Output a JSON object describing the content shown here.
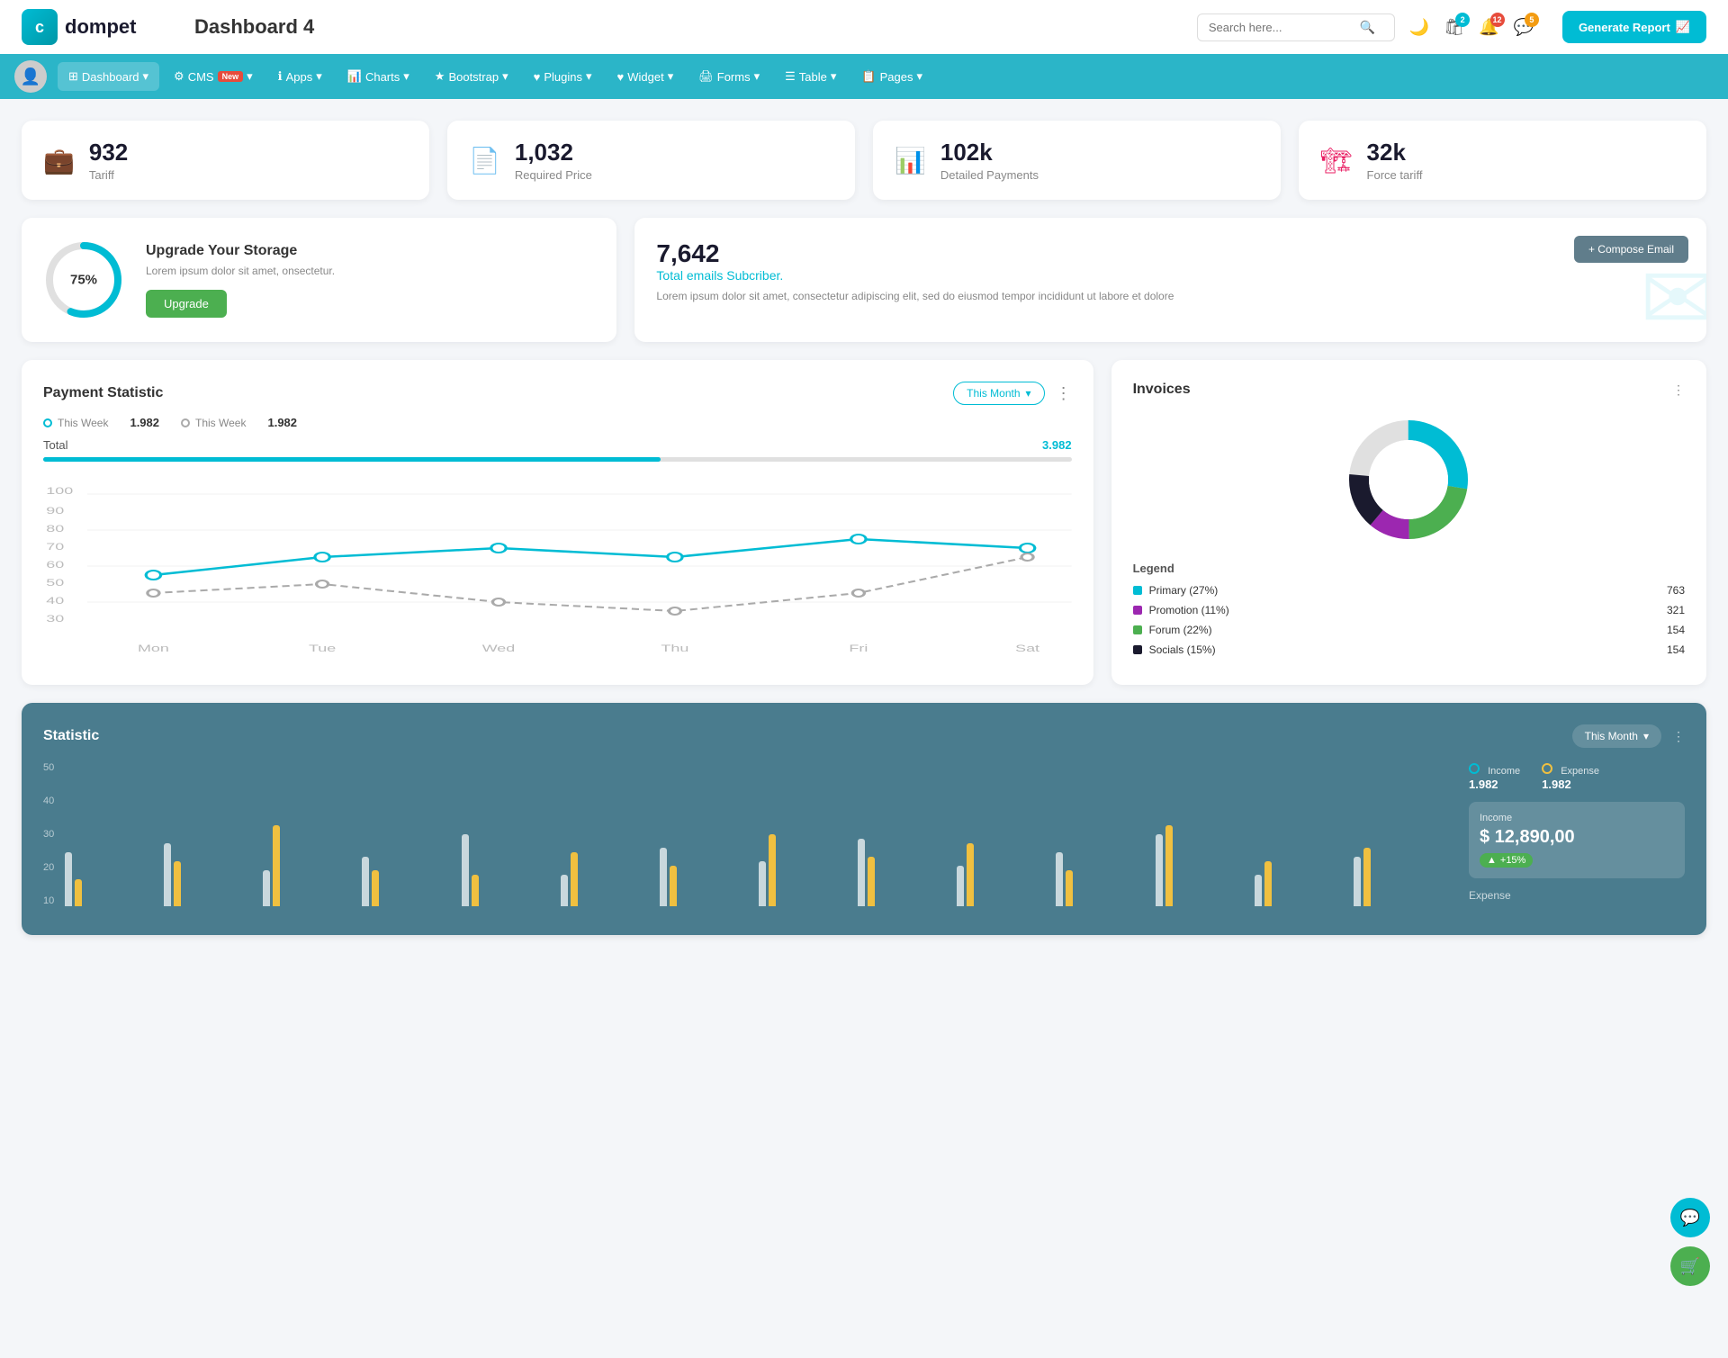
{
  "header": {
    "logo_text": "dompet",
    "page_title": "Dashboard 4",
    "search_placeholder": "Search here...",
    "generate_btn_label": "Generate Report",
    "icons": {
      "cart_badge": "2",
      "notif_badge": "12",
      "msg_badge": "5"
    }
  },
  "nav": {
    "items": [
      {
        "label": "Dashboard",
        "icon": "⊞",
        "active": true
      },
      {
        "label": "CMS",
        "icon": "⚙",
        "badge": "New"
      },
      {
        "label": "Apps",
        "icon": "ℹ"
      },
      {
        "label": "Charts",
        "icon": "📊"
      },
      {
        "label": "Bootstrap",
        "icon": "★"
      },
      {
        "label": "Plugins",
        "icon": "♥"
      },
      {
        "label": "Widget",
        "icon": "♥"
      },
      {
        "label": "Forms",
        "icon": "🖨"
      },
      {
        "label": "Table",
        "icon": "☰"
      },
      {
        "label": "Pages",
        "icon": "📋"
      }
    ]
  },
  "stat_cards": [
    {
      "value": "932",
      "label": "Tariff",
      "icon": "💼",
      "color": "#00bcd4"
    },
    {
      "value": "1,032",
      "label": "Required Price",
      "icon": "📄",
      "color": "#e74c3c"
    },
    {
      "value": "102k",
      "label": "Detailed Payments",
      "icon": "📊",
      "color": "#9c27b0"
    },
    {
      "value": "32k",
      "label": "Force tariff",
      "icon": "🏗",
      "color": "#e91e63"
    }
  ],
  "storage": {
    "percent": 75,
    "title": "Upgrade Your Storage",
    "desc": "Lorem ipsum dolor sit amet, onsectetur.",
    "btn_label": "Upgrade"
  },
  "email": {
    "number": "7,642",
    "sub_label": "Total emails Subcriber.",
    "desc": "Lorem ipsum dolor sit amet, consectetur adipiscing elit, sed do eiusmod tempor incididunt ut labore et dolore",
    "compose_btn": "+ Compose Email"
  },
  "payment": {
    "title": "Payment Statistic",
    "filter_label": "This Month",
    "legend1_label": "This Week",
    "legend1_value": "1.982",
    "legend2_label": "This Week",
    "legend2_value": "1.982",
    "total_label": "Total",
    "total_value": "3.982",
    "y_labels": [
      "100",
      "90",
      "80",
      "70",
      "60",
      "50",
      "40",
      "30"
    ],
    "x_labels": [
      "Mon",
      "Tue",
      "Wed",
      "Thu",
      "Fri",
      "Sat"
    ],
    "line1_points": "40,160 120,110 240,100 360,90 480,105 600,90",
    "line2_points": "40,130 120,120 240,130 360,150 480,130 600,95"
  },
  "invoices": {
    "title": "Invoices",
    "donut": {
      "segments": [
        {
          "label": "Primary (27%)",
          "color": "#00bcd4",
          "value": 763,
          "percent": 27
        },
        {
          "label": "Promotion (11%)",
          "color": "#9c27b0",
          "value": 321,
          "percent": 11
        },
        {
          "label": "Forum (22%)",
          "color": "#4caf50",
          "value": 154,
          "percent": 22
        },
        {
          "label": "Socials (15%)",
          "color": "#1a1a2e",
          "value": 154,
          "percent": 15
        }
      ]
    }
  },
  "statistic": {
    "title": "Statistic",
    "filter_label": "This Month",
    "income_label": "Income",
    "income_value": "1.982",
    "expense_label": "Expense",
    "expense_value": "1.982",
    "income_amount": "$ 12,890,00",
    "income_change": "+15%",
    "expense_label2": "Expense",
    "bars": [
      {
        "white": 60,
        "yellow": 30
      },
      {
        "white": 70,
        "yellow": 50
      },
      {
        "white": 40,
        "yellow": 90
      },
      {
        "white": 55,
        "yellow": 40
      },
      {
        "white": 80,
        "yellow": 35
      },
      {
        "white": 35,
        "yellow": 60
      },
      {
        "white": 65,
        "yellow": 45
      },
      {
        "white": 50,
        "yellow": 80
      },
      {
        "white": 75,
        "yellow": 55
      },
      {
        "white": 45,
        "yellow": 70
      },
      {
        "white": 60,
        "yellow": 40
      },
      {
        "white": 80,
        "yellow": 90
      },
      {
        "white": 35,
        "yellow": 50
      },
      {
        "white": 55,
        "yellow": 65
      }
    ]
  }
}
